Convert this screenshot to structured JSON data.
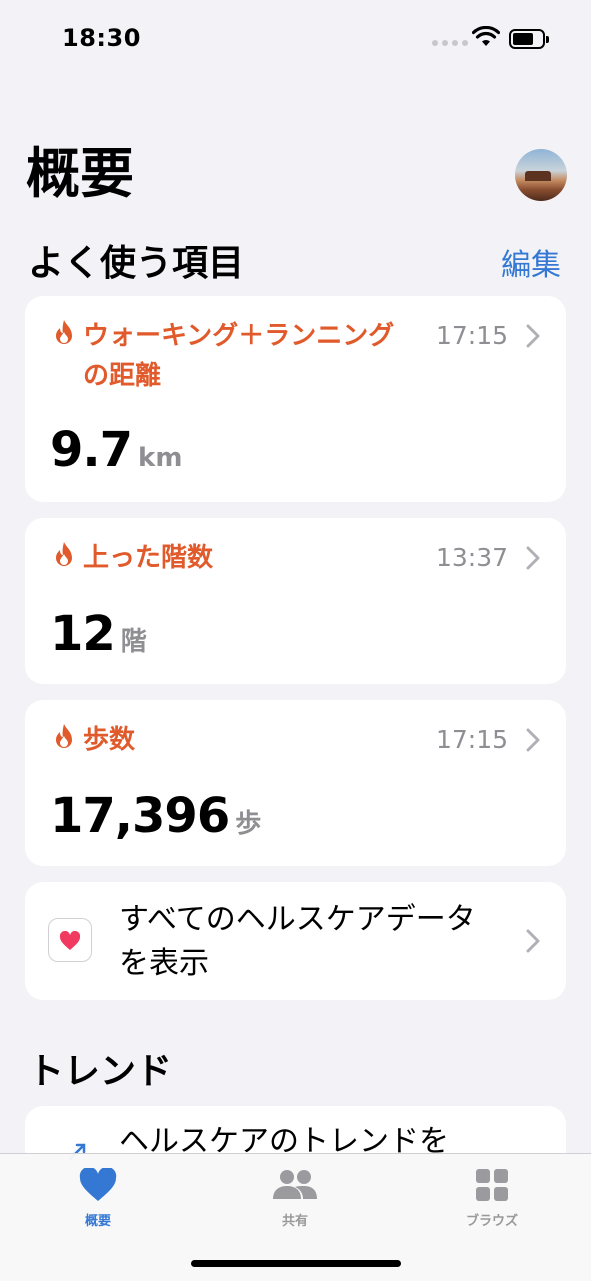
{
  "status_bar": {
    "time": "18:30"
  },
  "page": {
    "title": "概要"
  },
  "favorites": {
    "heading": "よく使う項目",
    "edit_label": "編集",
    "items": [
      {
        "title": "ウォーキング＋ランニングの距離",
        "time": "17:15",
        "value": "9.7",
        "unit": "km"
      },
      {
        "title": "上った階数",
        "time": "13:37",
        "value": "12",
        "unit": "階"
      },
      {
        "title": "歩数",
        "time": "17:15",
        "value": "17,396",
        "unit": "歩"
      }
    ]
  },
  "all_data": {
    "label": "すべてのヘルスケアデータを表示",
    "icon": "heart-icon"
  },
  "trends": {
    "heading": "トレンド",
    "card_text": "ヘルスケアのトレンドを"
  },
  "tab_bar": {
    "tabs": [
      {
        "label": "概要",
        "icon": "heart-icon",
        "active": true
      },
      {
        "label": "共有",
        "icon": "people-icon",
        "active": false
      },
      {
        "label": "ブラウズ",
        "icon": "grid-icon",
        "active": false
      }
    ]
  },
  "colors": {
    "accent": "#3478d4",
    "highlight": "#e05a2b",
    "background": "#f2f2f7"
  }
}
